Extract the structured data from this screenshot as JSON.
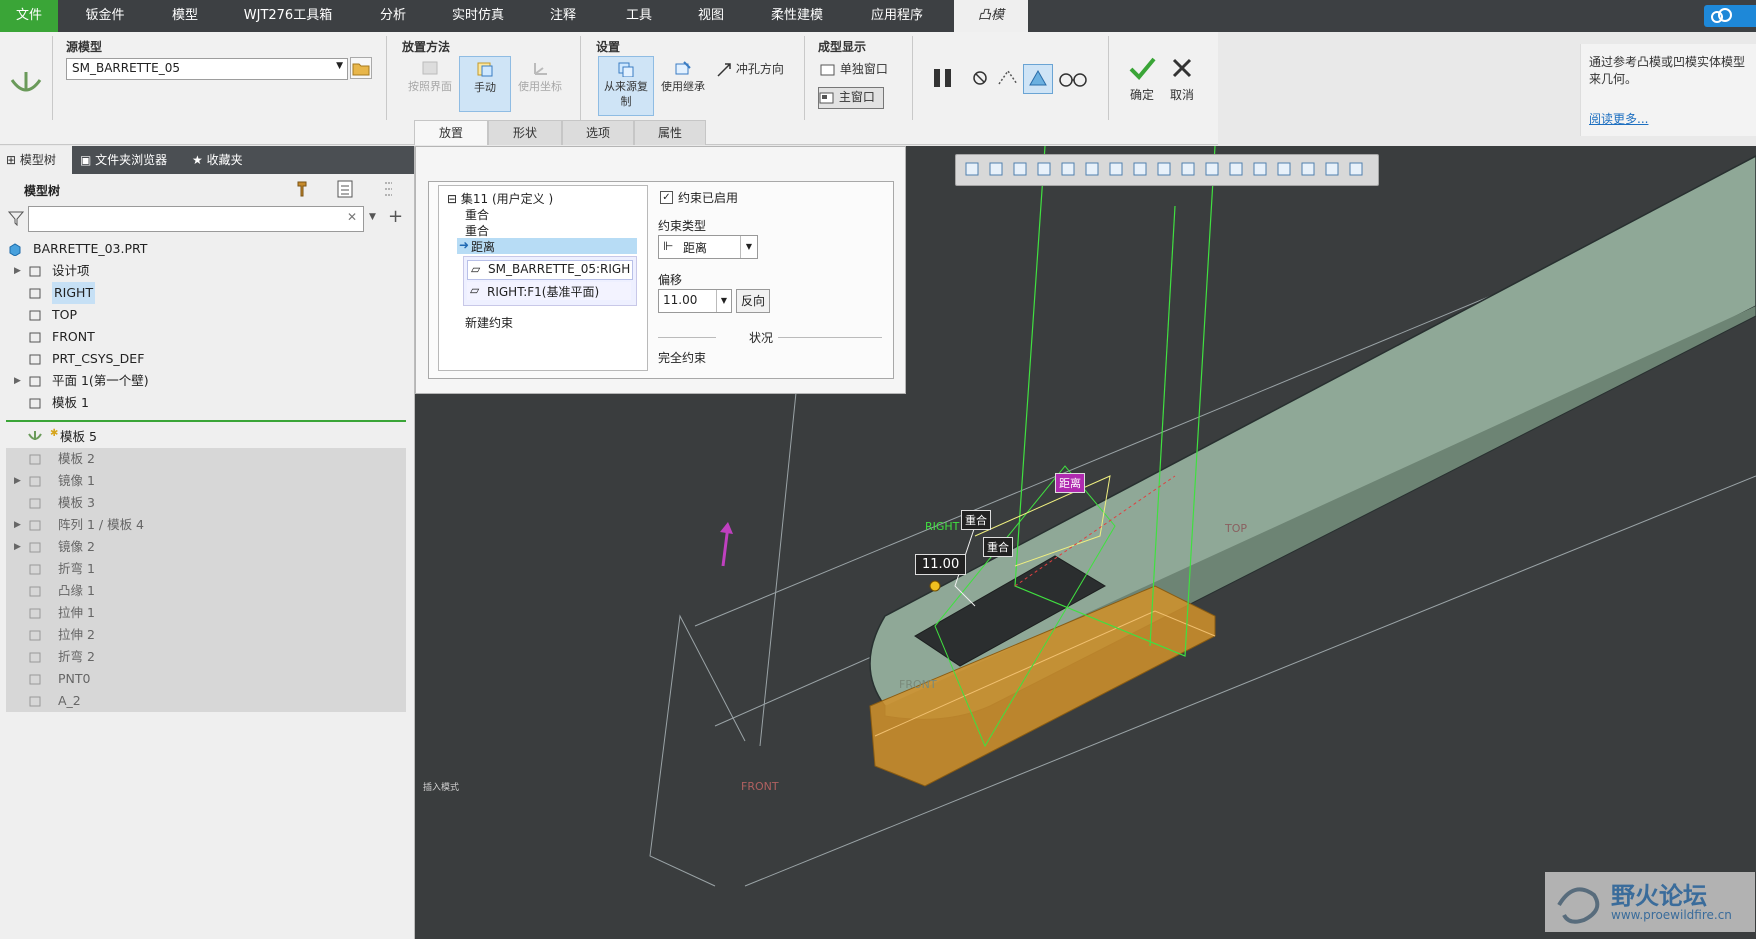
{
  "menu": {
    "items": [
      "文件",
      "钣金件",
      "模型",
      "WJT276工具箱",
      "分析",
      "实时仿真",
      "注释",
      "工具",
      "视图",
      "柔性建模",
      "应用程序"
    ],
    "active_tab": "凸模"
  },
  "ribbon": {
    "source_model": {
      "title": "源模型",
      "value": "SM_BARRETTE_05"
    },
    "placement_method": {
      "title": "放置方法",
      "buttons": [
        "按照界面",
        "手动",
        "使用坐标"
      ]
    },
    "settings": {
      "title": "设置",
      "buttons": [
        "从来源复制",
        "使用继承"
      ],
      "punch_dir": "冲孔方向"
    },
    "form_display": {
      "title": "成型显示",
      "separate_window": "单独窗口",
      "main_window": "主窗口"
    },
    "confirm": "确定",
    "cancel": "取消",
    "tabs": [
      "放置",
      "形状",
      "选项",
      "属性"
    ],
    "dots": "····"
  },
  "help": {
    "text": "通过参考凸模或凹模实体模型来几何。",
    "link": "阅读更多..."
  },
  "left_panel": {
    "tabs": [
      "模型树",
      "文件夹浏览器",
      "收藏夹"
    ],
    "tree_title": "模型树",
    "root": "BARRETTE_03.PRT",
    "items": [
      {
        "label": "设计项",
        "expand": true,
        "grey": false
      },
      {
        "label": "RIGHT",
        "expand": false,
        "grey": false
      },
      {
        "label": "TOP",
        "expand": false,
        "grey": false
      },
      {
        "label": "FRONT",
        "expand": false,
        "grey": false
      },
      {
        "label": "PRT_CSYS_DEF",
        "expand": false,
        "grey": false
      },
      {
        "label": "平面 1(第一个壁)",
        "expand": true,
        "grey": false
      },
      {
        "label": "模板 1",
        "expand": false,
        "grey": false
      }
    ],
    "insert_item": "模板 5",
    "grey_items": [
      {
        "label": "模板 2",
        "expand": false
      },
      {
        "label": "镜像 1",
        "expand": true
      },
      {
        "label": "模板 3",
        "expand": false
      },
      {
        "label": "阵列 1 / 模板 4",
        "expand": true
      },
      {
        "label": "镜像 2",
        "expand": true
      },
      {
        "label": "折弯 1",
        "expand": false
      },
      {
        "label": "凸缘 1",
        "expand": false
      },
      {
        "label": "拉伸 1",
        "expand": false
      },
      {
        "label": "拉伸 2",
        "expand": false
      },
      {
        "label": "折弯 2",
        "expand": false
      },
      {
        "label": "PNT0",
        "expand": false
      },
      {
        "label": "A_2",
        "expand": false
      }
    ]
  },
  "dialog": {
    "set_title": "集11 (用户定义 )",
    "constraints": [
      "重合",
      "重合",
      "距离"
    ],
    "refs": [
      "SM_BARRETTE_05:RIGH",
      "RIGHT:F1(基准平面)"
    ],
    "new_constraint": "新建约束",
    "enabled_label": "约束已启用",
    "type_label": "约束类型",
    "type_value": "距离",
    "offset_label": "偏移",
    "offset_value": "11.00",
    "reverse": "反向",
    "status_label": "状况",
    "status_value": "完全约束"
  },
  "viewport": {
    "labels": {
      "distance": "距离",
      "coincide1": "重合",
      "coincide2": "重合",
      "dim": "11.00",
      "right": "RIGHT",
      "front": "FRONT",
      "front2": "FRONT",
      "top": "TOP"
    },
    "corner_text": "插入模式",
    "watermark_name": "野火论坛",
    "watermark_url": "www.proewildfire.cn"
  },
  "colors": {
    "accent_green": "#3aa537",
    "topbar": "#3d4043",
    "viewport_bg": "#3a3d3e",
    "part_fill": "#8fa897",
    "die_orange": "#d2922a",
    "distance_tag": "#b02ab0"
  }
}
